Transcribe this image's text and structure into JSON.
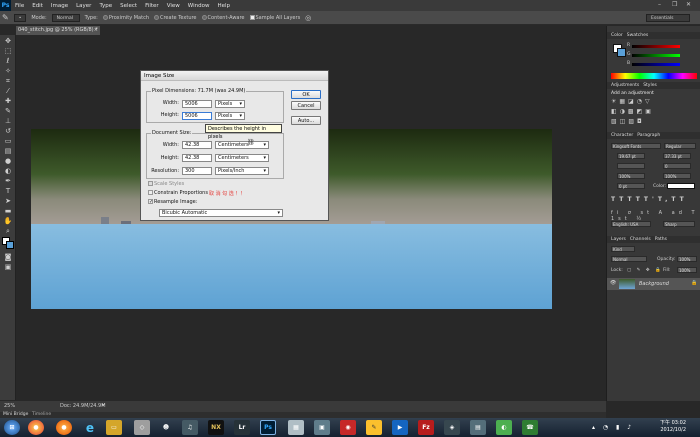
{
  "menubar": {
    "logo": "Ps",
    "items": [
      "File",
      "Edit",
      "Image",
      "Layer",
      "Type",
      "Select",
      "Filter",
      "View",
      "Window",
      "Help"
    ]
  },
  "optionsbar": {
    "mode_label": "Mode:",
    "mode_value": "Normal",
    "type_label": "Type:",
    "proximity_match": "Proximity Match",
    "create_texture": "Create Texture",
    "content_aware": "Content-Aware",
    "sample_all_layers": "Sample All Layers",
    "workspace": "Essentials"
  },
  "document": {
    "tab_title": "040_stitch.jpg @ 25% (RGB/8) *",
    "zoom": "25%",
    "doc_size": "Doc: 24.9M/24.9M"
  },
  "dialog": {
    "title": "Image Size",
    "pixel_dimensions": "Pixel Dimensions:  71.7M (was 24.9M)",
    "width_label": "Width:",
    "width_value": "5006",
    "width_unit": "Pixels",
    "height_label": "Height:",
    "height_value": "5006",
    "height_unit": "Pixels",
    "document_size_label": "Document Size:",
    "doc_width_label": "Width:",
    "doc_width_value": "42.38",
    "doc_width_unit": "Centimeters",
    "doc_height_label": "Height:",
    "doc_height_value": "42.38",
    "doc_height_unit": "Centimeters",
    "resolution_label": "Resolution:",
    "resolution_value": "300",
    "resolution_unit": "Pixels/Inch",
    "scale_styles": "Scale Styles",
    "constrain_proportions": "Constrain Proportions",
    "constrain_note": "取 消 勾 选 ！！",
    "resample_image": "Resample Image:",
    "resample_method": "Bicubic Automatic",
    "ok": "OK",
    "cancel": "Cancel",
    "auto": "Auto...",
    "tooltip": "Describes the height in pixels"
  },
  "panels": {
    "color_tab": "Color",
    "swatches_tab": "Swatches",
    "adjustments_tab": "Adjustments",
    "styles_tab": "Styles",
    "add_adjustment": "Add an adjustment",
    "character_tab": "Character",
    "paragraph_tab": "Paragraph",
    "font_family": "Kingsoft Fonts",
    "font_style": "Regular",
    "size_value": "19.67 pt",
    "leading_value": "37.33 pt",
    "tracking_value": "0",
    "scale_v": "100%",
    "scale_h": "100%",
    "baseline": "0 pt",
    "color_label": "Color:",
    "language": "English: USA",
    "aa": "Sharp",
    "layers_tab": "Layers",
    "channels_tab": "Channels",
    "paths_tab": "Paths",
    "kind": "Kind",
    "blend_mode": "Normal",
    "opacity_label": "Opacity:",
    "opacity_value": "100%",
    "lock_label": "Lock:",
    "fill_label": "Fill:",
    "fill_value": "100%",
    "layer_name": "Background"
  },
  "bottom_tabs": {
    "mini_bridge": "Mini Bridge",
    "timeline": "Timeline"
  },
  "taskbar": {
    "time": "下午 03:02",
    "date": "2012/10/2"
  },
  "colors": {
    "ps_blue": "#31a8ff",
    "accent_red": "#e53935"
  }
}
